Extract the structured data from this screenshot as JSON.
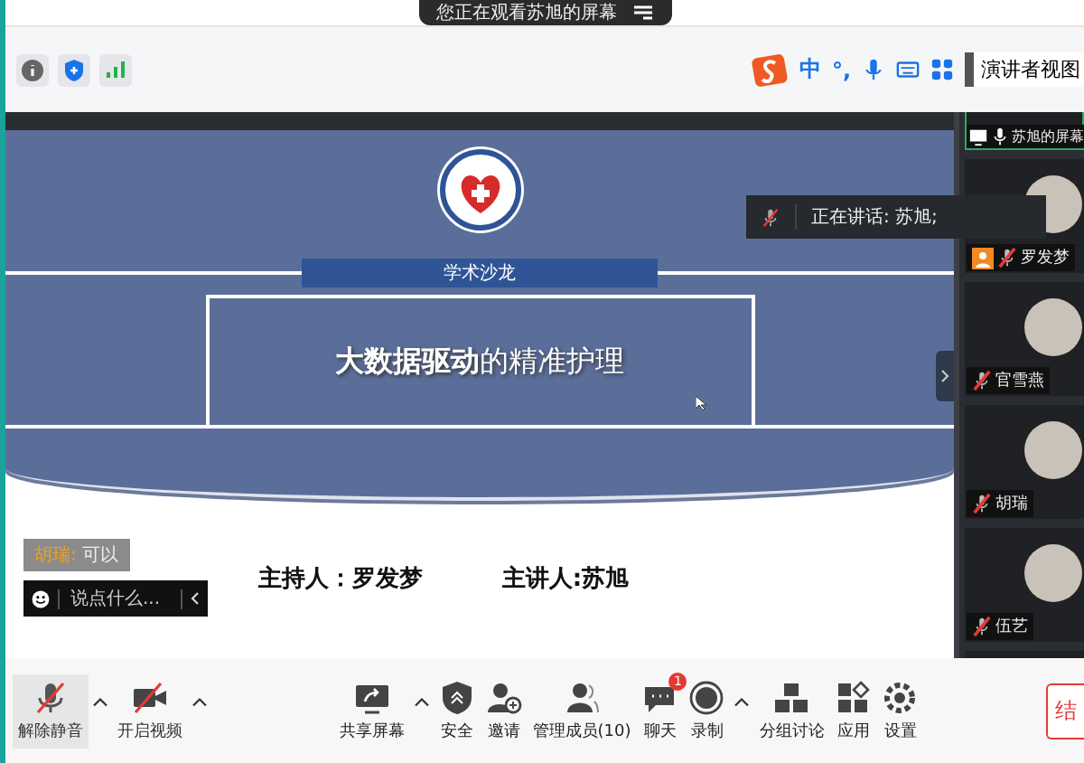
{
  "banner": {
    "text": "您正在观看苏旭的屏幕"
  },
  "ime": {
    "mode": "中",
    "punct": "°,"
  },
  "view_button": {
    "label": "演讲者视图"
  },
  "slide": {
    "badge": "学术沙龙",
    "title": "**大数据驱动**的精准护理",
    "host_line": "主持人：罗发梦",
    "speaker_line": "主讲人:苏旭"
  },
  "speaking": {
    "text": "正在讲话: 苏旭;",
    "muted": true
  },
  "participants": [
    {
      "name": "苏旭的屏幕",
      "kind": "screen",
      "muted": false,
      "active": true
    },
    {
      "name": "罗发梦",
      "kind": "host",
      "muted": true,
      "active": false
    },
    {
      "name": "官雪燕",
      "kind": "member",
      "muted": true,
      "active": false
    },
    {
      "name": "胡瑞",
      "kind": "member",
      "muted": true,
      "active": false
    },
    {
      "name": "伍艺",
      "kind": "member",
      "muted": true,
      "active": false
    },
    {
      "kind": "partial",
      "active": false
    }
  ],
  "chat": {
    "messages": [
      {
        "sender": "胡瑞:",
        "text": "可以"
      }
    ],
    "input": {
      "placeholder": "说点什么..."
    }
  },
  "toolbar": {
    "items": [
      {
        "label": "解除静音",
        "kind": "mic",
        "off": true,
        "menu": true
      },
      {
        "label": "开启视频",
        "kind": "video",
        "off": true,
        "menu": true
      },
      {
        "label": "共享屏幕",
        "kind": "share",
        "off": false,
        "menu": true
      },
      {
        "label": "安全",
        "kind": "shield",
        "off": false,
        "menu": false
      },
      {
        "label": "邀请",
        "kind": "invite",
        "off": false,
        "menu": false
      },
      {
        "label": "管理成员(10)",
        "kind": "members",
        "off": false,
        "menu": false
      },
      {
        "label": "聊天",
        "kind": "chat",
        "off": false,
        "menu": false,
        "badge": "1"
      },
      {
        "label": "录制",
        "kind": "record",
        "off": false,
        "menu": true
      },
      {
        "label": "分组讨论",
        "kind": "breakout",
        "off": false,
        "menu": false
      },
      {
        "label": "应用",
        "kind": "apps",
        "off": false,
        "menu": false
      },
      {
        "label": "设置",
        "kind": "settings",
        "off": false,
        "menu": false
      }
    ],
    "end_button": "结"
  }
}
